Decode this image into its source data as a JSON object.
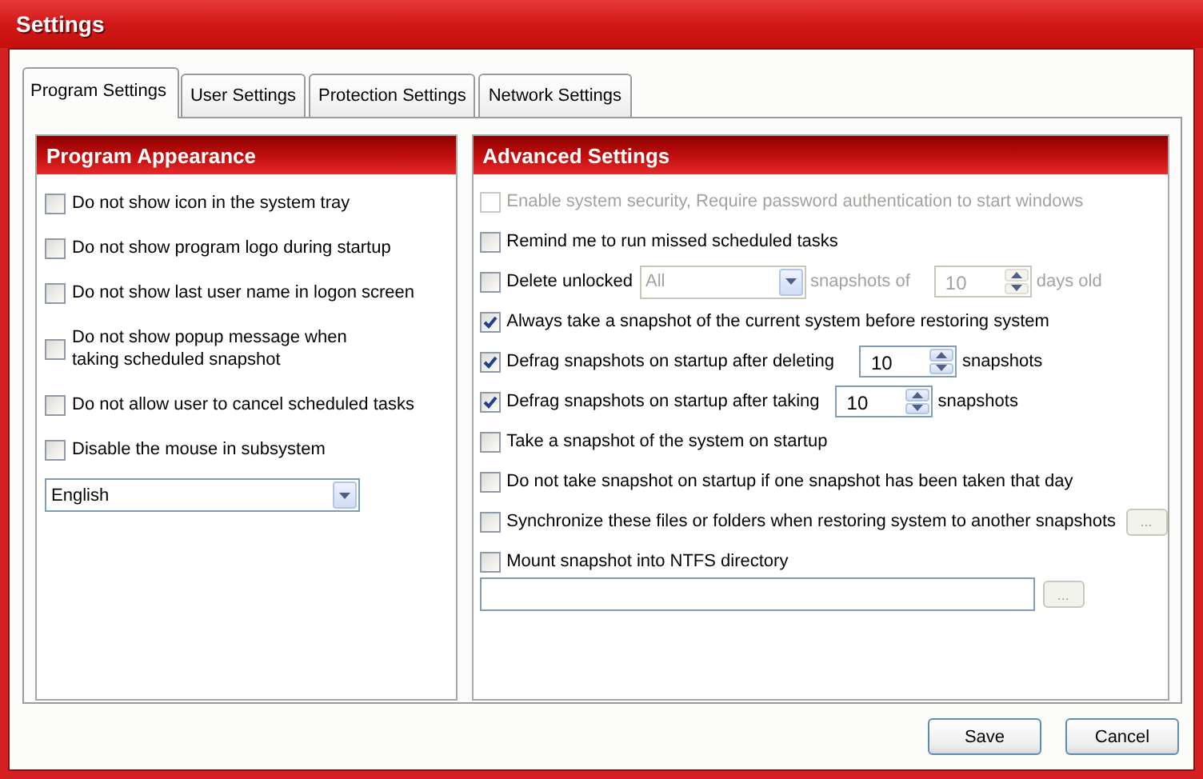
{
  "window": {
    "title": "Settings"
  },
  "tabs": [
    {
      "label": "Program Settings",
      "selected": true
    },
    {
      "label": "User Settings",
      "selected": false
    },
    {
      "label": "Protection Settings",
      "selected": false
    },
    {
      "label": "Network Settings",
      "selected": false
    }
  ],
  "program_appearance": {
    "title": "Program Appearance",
    "items": [
      {
        "label": "Do not show icon in the system tray",
        "checked": false
      },
      {
        "label": "Do not show program logo during startup",
        "checked": false
      },
      {
        "label": "Do not show last user name in logon screen",
        "checked": false
      },
      {
        "label": "Do not show popup message when\ntaking scheduled snapshot",
        "checked": false
      },
      {
        "label": "Do not allow user to cancel scheduled tasks",
        "checked": false
      },
      {
        "label": "Disable the mouse in subsystem",
        "checked": false
      }
    ],
    "language": {
      "value": "English"
    }
  },
  "advanced_settings": {
    "title": "Advanced Settings",
    "items": [
      {
        "kind": "check",
        "label": "Enable system security, Require password authentication to start windows",
        "checked": false,
        "disabled": true
      },
      {
        "kind": "check",
        "label": "Remind me to run missed scheduled tasks",
        "checked": false,
        "disabled": false
      },
      {
        "kind": "delete",
        "label": "Delete unlocked",
        "checked": false,
        "disabled": false,
        "select_value": "All",
        "middle": "snapshots of",
        "value": "10",
        "suffix": "days old",
        "controls_disabled": true
      },
      {
        "kind": "check",
        "label": "Always take a snapshot of the current system before restoring system",
        "checked": true,
        "disabled": false
      },
      {
        "kind": "spin",
        "label": "Defrag snapshots on startup after deleting",
        "checked": true,
        "disabled": false,
        "value": "10",
        "suffix": "snapshots"
      },
      {
        "kind": "spin",
        "label": "Defrag snapshots on startup after taking",
        "checked": true,
        "disabled": false,
        "value": "10",
        "suffix": "snapshots"
      },
      {
        "kind": "check",
        "label": "Take a snapshot of the system on startup",
        "checked": false,
        "disabled": false
      },
      {
        "kind": "check",
        "label": "Do not take snapshot on startup if one snapshot has been taken that day",
        "checked": false,
        "disabled": false
      },
      {
        "kind": "browse",
        "label": "Synchronize these files or folders when restoring system to another snapshots",
        "checked": false,
        "disabled": false,
        "button": "..."
      },
      {
        "kind": "path",
        "label": "Mount snapshot into NTFS directory",
        "checked": false,
        "disabled": false,
        "button": "..."
      }
    ]
  },
  "buttons": [
    {
      "label": "Save"
    },
    {
      "label": "Cancel"
    }
  ]
}
